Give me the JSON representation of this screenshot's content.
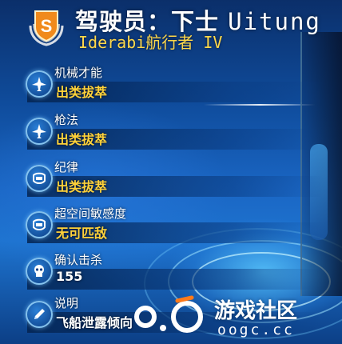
{
  "header": {
    "rank_badge_letter": "S",
    "title_prefix": "驾驶员：下士",
    "title_name": "Uitung",
    "subtitle": "Iderabi航行者 IV"
  },
  "stats": [
    {
      "label": "机械才能",
      "value": "出类拔萃",
      "icon": "jet-icon"
    },
    {
      "label": "枪法",
      "value": "出类拔萃",
      "icon": "jet-icon"
    },
    {
      "label": "纪律",
      "value": "出类拔萃",
      "icon": "shield-icon"
    },
    {
      "label": "超空间敏感度",
      "value": "无可匹敌",
      "icon": "shield-icon"
    },
    {
      "label": "确认击杀",
      "value": "155",
      "icon": "skull-icon"
    },
    {
      "label": "说明",
      "value": "飞船泄露倾向",
      "icon": "pencil-icon"
    }
  ],
  "watermark": {
    "name": "游戏社区",
    "domain": "oogc.cc"
  },
  "colors": {
    "value_yellow": "#ffd23a",
    "subtitle_yellow": "#ffd84a",
    "badge_orange": "#f08a1c",
    "badge_silver": "#d7dde6"
  }
}
